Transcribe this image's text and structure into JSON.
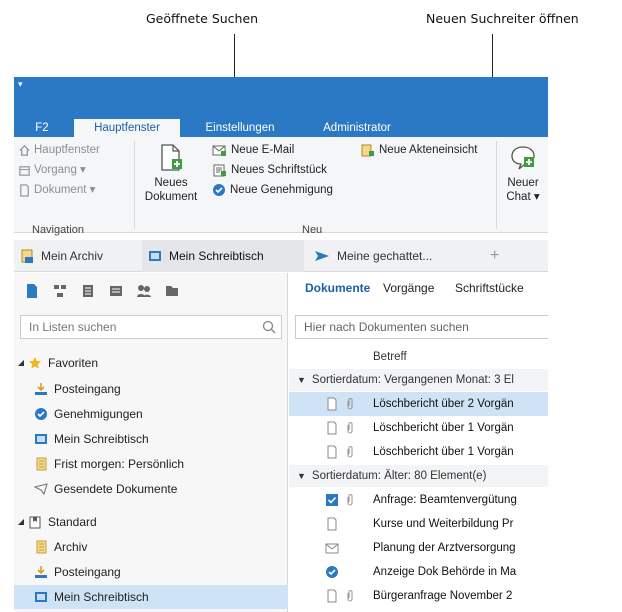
{
  "callouts": {
    "opened_searches": "Geöffnete Suchen",
    "new_search_tab": "Neuen Suchreiter öffnen"
  },
  "ribbon_tabs": [
    "F2",
    "Hauptfenster",
    "Einstellungen",
    "Administrator"
  ],
  "ribbon": {
    "navigation": {
      "items": [
        "Hauptfenster",
        "Vorgang ▾",
        "Dokument ▾"
      ],
      "group_label": "Navigation"
    },
    "new": {
      "big_button": [
        "Neues",
        "Dokument"
      ],
      "small": [
        "Neue E-Mail",
        "Neues Schriftstück",
        "Neue Genehmigung"
      ],
      "files_view": "Neue Akteneinsicht",
      "group_label": "Neu"
    },
    "chat": [
      "Neuer",
      "Chat ▾"
    ]
  },
  "search_tabs": [
    "Mein Archiv",
    "Mein Schreibtisch",
    "Meine gechattet..."
  ],
  "add_tab": "+",
  "left": {
    "search_placeholder": "In Listen suchen",
    "tree": [
      {
        "label": "Favoriten",
        "level": 0
      },
      {
        "label": "Posteingang",
        "level": 1
      },
      {
        "label": "Genehmigungen",
        "level": 1
      },
      {
        "label": "Mein Schreibtisch",
        "level": 1
      },
      {
        "label": "Frist morgen: Persönlich",
        "level": 1
      },
      {
        "label": "Gesendete Dokumente",
        "level": 1
      },
      {
        "label": "Standard",
        "level": 0
      },
      {
        "label": "Archiv",
        "level": 1
      },
      {
        "label": "Posteingang",
        "level": 1
      },
      {
        "label": "Mein Schreibtisch",
        "level": 1
      }
    ]
  },
  "right": {
    "tabs": [
      "Dokumente",
      "Vorgänge",
      "Schriftstücke"
    ],
    "search_placeholder": "Hier nach Dokumenten suchen",
    "column": "Betreff",
    "groups": [
      "Sortierdatum: Vergangenen Monat: 3 El",
      "Sortierdatum: Älter: 80 Element(e)"
    ],
    "rows_group1": [
      "Löschbericht über 2 Vorgän",
      "Löschbericht über 1 Vorgän",
      "Löschbericht über 1 Vorgän"
    ],
    "rows_group2": [
      "Anfrage: Beamtenvergütung",
      "Kurse und Weiterbildung Pr",
      "Planung der Arztversorgung",
      "Anzeige Dok Behörde in Ma",
      "Bürgeranfrage November 2"
    ]
  },
  "colors": {
    "accent": "#2b78c5",
    "selection": "#cfe3f6",
    "favorite_star": "#f2b51c",
    "upload_orange": "#e59a1d"
  }
}
